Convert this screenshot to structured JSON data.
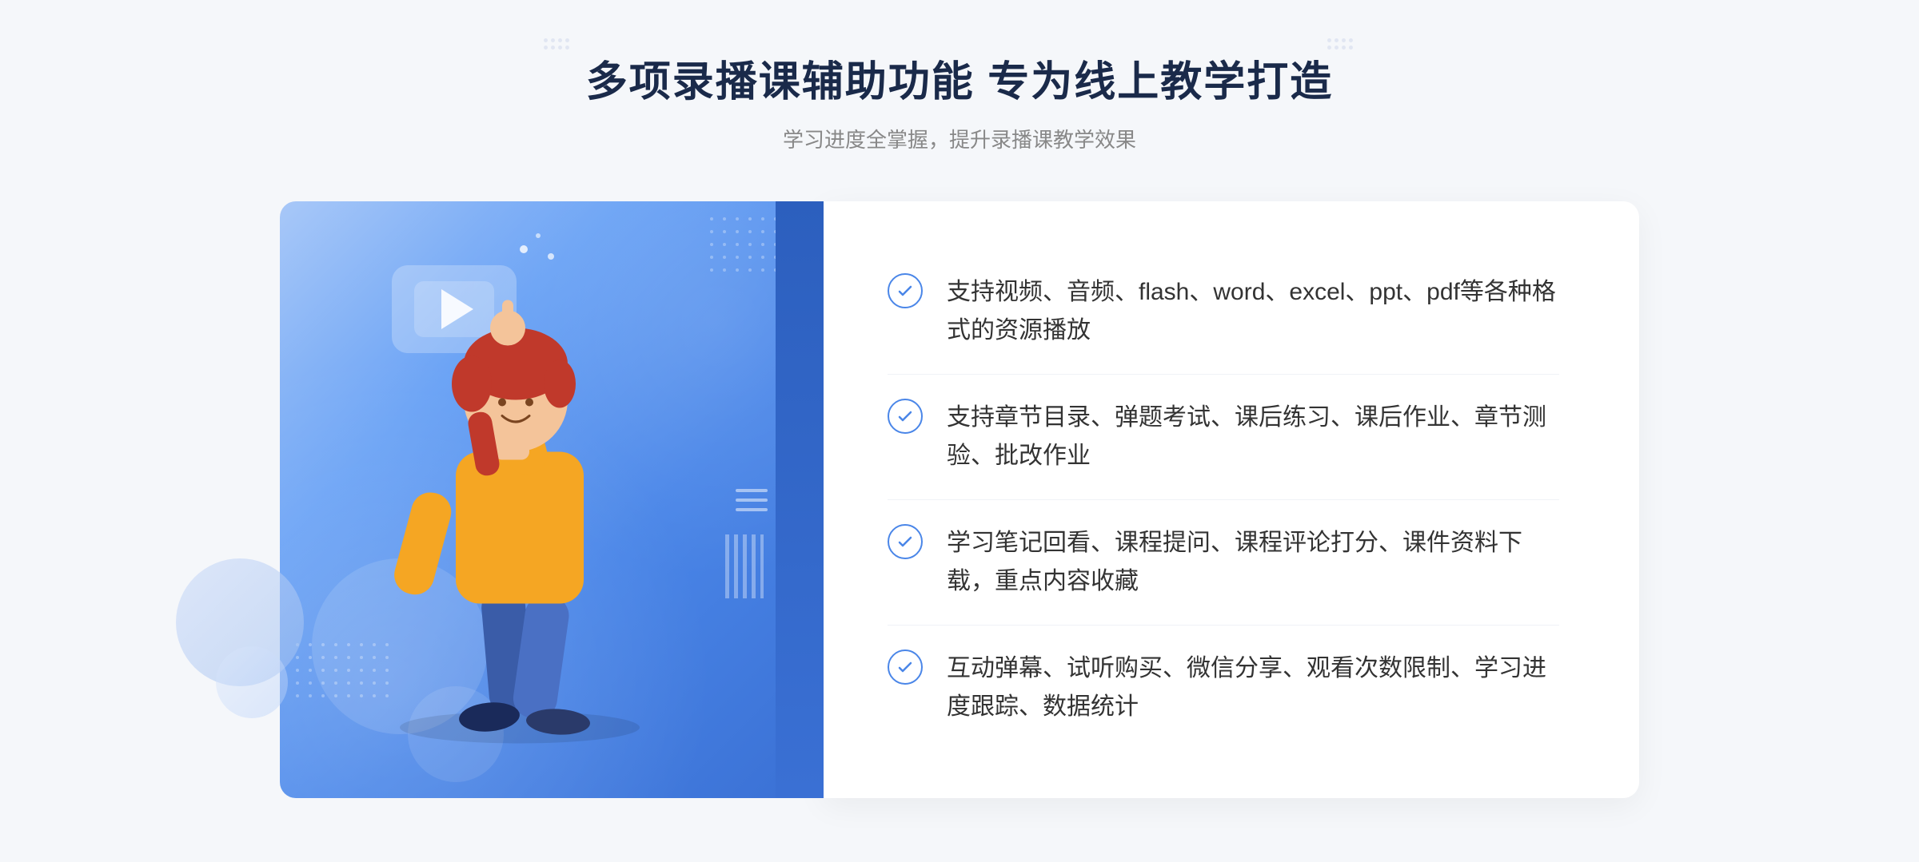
{
  "header": {
    "main_title": "多项录播课辅助功能 专为线上教学打造",
    "sub_title": "学习进度全掌握，提升录播课教学效果"
  },
  "features": [
    {
      "id": 1,
      "text": "支持视频、音频、flash、word、excel、ppt、pdf等各种格式的资源播放"
    },
    {
      "id": 2,
      "text": "支持章节目录、弹题考试、课后练习、课后作业、章节测验、批改作业"
    },
    {
      "id": 3,
      "text": "学习笔记回看、课程提问、课程评论打分、课件资料下载，重点内容收藏"
    },
    {
      "id": 4,
      "text": "互动弹幕、试听购买、微信分享、观看次数限制、学习进度跟踪、数据统计"
    }
  ],
  "colors": {
    "accent": "#4a86e8",
    "title": "#1a2a4a",
    "text": "#333333",
    "subtitle": "#888888",
    "bg": "#f5f7fa"
  }
}
